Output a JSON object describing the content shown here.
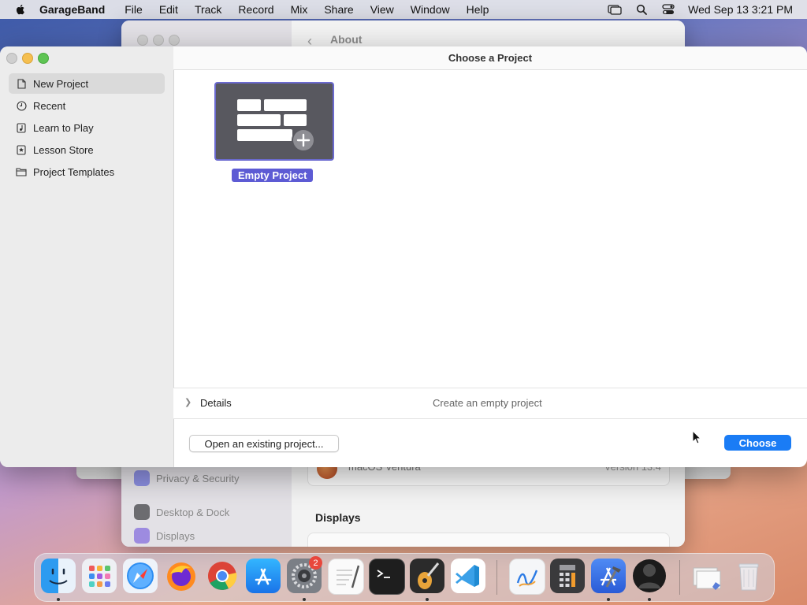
{
  "menubar": {
    "app_name": "GarageBand",
    "items": [
      "File",
      "Edit",
      "Track",
      "Record",
      "Mix",
      "Share",
      "View",
      "Window",
      "Help"
    ],
    "clock": "Wed Sep 13  3:21 PM"
  },
  "background_window": {
    "title": "About",
    "sidebar_items": [
      "Privacy & Security",
      "Desktop & Dock",
      "Displays"
    ],
    "os_name": "macOS Ventura",
    "os_version": "Version 13.4",
    "section_heading": "Displays"
  },
  "main_window": {
    "title": "Choose a Project",
    "sidebar": {
      "items": [
        {
          "label": "New Project",
          "icon": "document-icon",
          "selected": true
        },
        {
          "label": "Recent",
          "icon": "clock-icon",
          "selected": false
        },
        {
          "label": "Learn to Play",
          "icon": "music-note-icon",
          "selected": false
        },
        {
          "label": "Lesson Store",
          "icon": "star-icon",
          "selected": false
        },
        {
          "label": "Project Templates",
          "icon": "folder-icon",
          "selected": false
        }
      ]
    },
    "templates": [
      {
        "label": "Empty Project",
        "selected": true
      }
    ],
    "details": {
      "label": "Details",
      "description": "Create an empty project"
    },
    "buttons": {
      "open_existing": "Open an existing project...",
      "choose": "Choose"
    },
    "accent_color": "#1a7cf5",
    "selection_color": "#5d5bd4"
  },
  "dock": {
    "apps": [
      {
        "name": "Finder",
        "icon": "finder-icon",
        "running": true
      },
      {
        "name": "Launchpad",
        "icon": "launchpad-icon",
        "running": false
      },
      {
        "name": "Safari",
        "icon": "safari-icon",
        "running": false
      },
      {
        "name": "Firefox",
        "icon": "firefox-icon",
        "running": false
      },
      {
        "name": "Chrome",
        "icon": "chrome-icon",
        "running": false
      },
      {
        "name": "App Store",
        "icon": "app-store-icon",
        "running": false
      },
      {
        "name": "System Settings",
        "icon": "system-settings-icon",
        "running": true,
        "badge": "2"
      },
      {
        "name": "TextEdit",
        "icon": "textedit-icon",
        "running": false
      },
      {
        "name": "Terminal",
        "icon": "terminal-icon",
        "running": false
      },
      {
        "name": "GarageBand",
        "icon": "garageband-icon",
        "running": true
      },
      {
        "name": "Visual Studio Code",
        "icon": "vscode-icon",
        "running": false
      },
      {
        "name": "Freeform",
        "icon": "freeform-icon",
        "running": false
      },
      {
        "name": "Calculator",
        "icon": "calculator-icon",
        "running": false
      },
      {
        "name": "Xcode",
        "icon": "xcode-icon",
        "running": true
      },
      {
        "name": "Unknown App",
        "icon": "dark-circle-app-icon",
        "running": true
      },
      {
        "name": "Downloads",
        "icon": "downloads-stack-icon",
        "running": false
      },
      {
        "name": "Trash",
        "icon": "trash-icon",
        "running": false
      }
    ]
  }
}
